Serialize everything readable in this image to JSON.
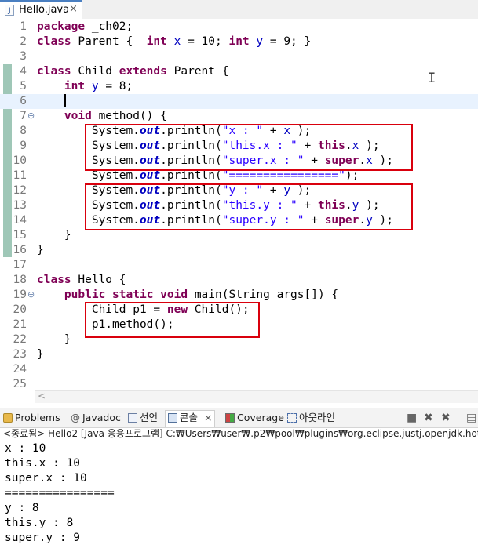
{
  "editor_tab": {
    "file_name": "Hello.java",
    "close_glyph": "×",
    "file_icon": "java-file-icon"
  },
  "code_lines": [
    {
      "num": "1",
      "parts": [
        [
          "kw",
          "package"
        ],
        [
          "plain",
          " _ch02;"
        ]
      ]
    },
    {
      "num": "2",
      "parts": [
        [
          "kw",
          "class"
        ],
        [
          "plain",
          " Parent {  "
        ],
        [
          "kw",
          "int"
        ],
        [
          "plain",
          " "
        ],
        [
          "fld",
          "x"
        ],
        [
          "plain",
          " = 10; "
        ],
        [
          "kw",
          "int"
        ],
        [
          "plain",
          " "
        ],
        [
          "fld",
          "y"
        ],
        [
          "plain",
          " = 9; }"
        ]
      ]
    },
    {
      "num": "3",
      "parts": []
    },
    {
      "num": "4",
      "parts": [
        [
          "kw",
          "class"
        ],
        [
          "plain",
          " Child "
        ],
        [
          "kw",
          "extends"
        ],
        [
          "plain",
          " Parent {"
        ]
      ]
    },
    {
      "num": "5",
      "parts": [
        [
          "plain",
          "    "
        ],
        [
          "kw",
          "int"
        ],
        [
          "plain",
          " "
        ],
        [
          "fld",
          "y"
        ],
        [
          "plain",
          " = 8;"
        ]
      ]
    },
    {
      "num": "6",
      "parts": [
        [
          "plain",
          "    "
        ],
        [
          "caret",
          ""
        ]
      ],
      "current": true
    },
    {
      "num": "7",
      "fold": "⊖",
      "parts": [
        [
          "plain",
          "    "
        ],
        [
          "kw",
          "void"
        ],
        [
          "plain",
          " method() {"
        ]
      ]
    },
    {
      "num": "8",
      "parts": [
        [
          "plain",
          "        System."
        ],
        [
          "sfld",
          "out"
        ],
        [
          "plain",
          ".println("
        ],
        [
          "str",
          "\"x : \""
        ],
        [
          "plain",
          " + "
        ],
        [
          "fld",
          "x"
        ],
        [
          "plain",
          " );"
        ]
      ]
    },
    {
      "num": "9",
      "parts": [
        [
          "plain",
          "        System."
        ],
        [
          "sfld",
          "out"
        ],
        [
          "plain",
          ".println("
        ],
        [
          "str",
          "\"this.x : \""
        ],
        [
          "plain",
          " + "
        ],
        [
          "kw",
          "this"
        ],
        [
          "plain",
          "."
        ],
        [
          "fld",
          "x"
        ],
        [
          "plain",
          " );"
        ]
      ]
    },
    {
      "num": "10",
      "parts": [
        [
          "plain",
          "        System."
        ],
        [
          "sfld",
          "out"
        ],
        [
          "plain",
          ".println("
        ],
        [
          "str",
          "\"super.x : \""
        ],
        [
          "plain",
          " + "
        ],
        [
          "kw",
          "super"
        ],
        [
          "plain",
          "."
        ],
        [
          "fld",
          "x"
        ],
        [
          "plain",
          " );"
        ]
      ]
    },
    {
      "num": "11",
      "parts": [
        [
          "plain",
          "        System."
        ],
        [
          "sfld",
          "out"
        ],
        [
          "plain",
          ".println("
        ],
        [
          "str",
          "\"================\""
        ],
        [
          "plain",
          ");"
        ]
      ]
    },
    {
      "num": "12",
      "parts": [
        [
          "plain",
          "        System."
        ],
        [
          "sfld",
          "out"
        ],
        [
          "plain",
          ".println("
        ],
        [
          "str",
          "\"y : \""
        ],
        [
          "plain",
          " + "
        ],
        [
          "fld",
          "y"
        ],
        [
          "plain",
          " );"
        ]
      ]
    },
    {
      "num": "13",
      "parts": [
        [
          "plain",
          "        System."
        ],
        [
          "sfld",
          "out"
        ],
        [
          "plain",
          ".println("
        ],
        [
          "str",
          "\"this.y : \""
        ],
        [
          "plain",
          " + "
        ],
        [
          "kw",
          "this"
        ],
        [
          "plain",
          "."
        ],
        [
          "fld",
          "y"
        ],
        [
          "plain",
          " );"
        ]
      ]
    },
    {
      "num": "14",
      "parts": [
        [
          "plain",
          "        System."
        ],
        [
          "sfld",
          "out"
        ],
        [
          "plain",
          ".println("
        ],
        [
          "str",
          "\"super.y : \""
        ],
        [
          "plain",
          " + "
        ],
        [
          "kw",
          "super"
        ],
        [
          "plain",
          "."
        ],
        [
          "fld",
          "y"
        ],
        [
          "plain",
          " );"
        ]
      ]
    },
    {
      "num": "15",
      "parts": [
        [
          "plain",
          "    }"
        ]
      ]
    },
    {
      "num": "16",
      "parts": [
        [
          "plain",
          "}"
        ]
      ]
    },
    {
      "num": "17",
      "parts": []
    },
    {
      "num": "18",
      "parts": [
        [
          "kw",
          "class"
        ],
        [
          "plain",
          " Hello {"
        ]
      ]
    },
    {
      "num": "19",
      "fold": "⊖",
      "parts": [
        [
          "plain",
          "    "
        ],
        [
          "kw",
          "public"
        ],
        [
          "plain",
          " "
        ],
        [
          "kw",
          "static"
        ],
        [
          "plain",
          " "
        ],
        [
          "kw",
          "void"
        ],
        [
          "plain",
          " main(String "
        ],
        [
          "plain",
          "args"
        ],
        [
          "plain",
          "[]) {"
        ]
      ]
    },
    {
      "num": "20",
      "parts": [
        [
          "plain",
          "        Child p1 = "
        ],
        [
          "kw",
          "new"
        ],
        [
          "plain",
          " Child();"
        ]
      ]
    },
    {
      "num": "21",
      "parts": [
        [
          "plain",
          "        p1.method();"
        ]
      ]
    },
    {
      "num": "22",
      "parts": [
        [
          "plain",
          "    }"
        ]
      ]
    },
    {
      "num": "23",
      "parts": [
        [
          "plain",
          "}"
        ]
      ]
    },
    {
      "num": "24",
      "parts": []
    },
    {
      "num": "25",
      "parts": []
    }
  ],
  "view_tabs": [
    {
      "label": "Problems",
      "icon": "problems-icon"
    },
    {
      "label": "Javadoc",
      "icon": "javadoc-icon"
    },
    {
      "label": "선언",
      "icon": "declaration-icon"
    },
    {
      "label": "콘솔",
      "icon": "console-icon",
      "active": true,
      "close": "×"
    },
    {
      "label": "Coverage",
      "icon": "coverage-icon"
    },
    {
      "label": "아웃라인",
      "icon": "outline-icon"
    }
  ],
  "console": {
    "header": "<종료됨> Hello2 [Java 응용프로그램] C:₩Users₩user₩.p2₩pool₩plugins₩org.eclipse.justj.openjdk.hotspot.jre.ful",
    "lines": [
      "x : 10",
      "this.x : 10",
      "super.x : 10",
      "================",
      "y : 8",
      "this.y : 8",
      "super.y : 9"
    ]
  },
  "colors": {
    "keyword": "#7f0055",
    "field": "#0000c0",
    "string": "#2a00ff",
    "highlight_box": "#d9000d"
  }
}
